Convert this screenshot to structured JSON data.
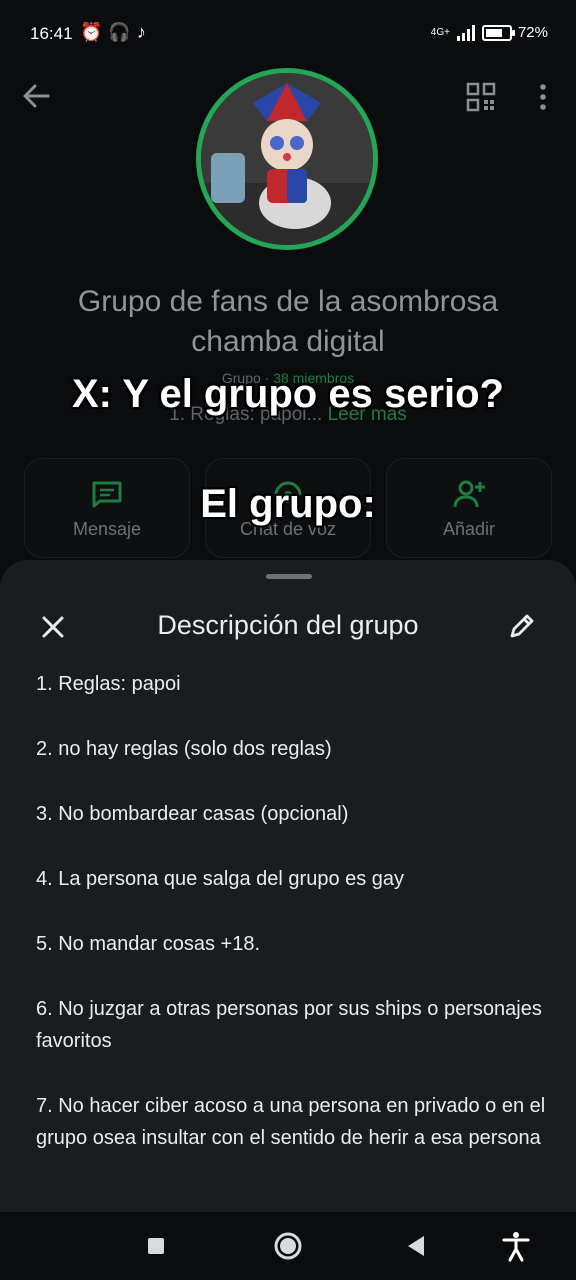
{
  "status": {
    "time": "16:41",
    "network": "4G+",
    "battery": "72%"
  },
  "group": {
    "name": "Grupo de fans de la asombrosa chamba digital",
    "type_label": "Grupo · ",
    "members": "38 miembros",
    "desc_preview": "1. Reglas: papoi... ",
    "read_more": "Leer más"
  },
  "overlay": {
    "line1": "X: Y el grupo es serio?",
    "line2": "El grupo:"
  },
  "actions": [
    {
      "label": "Mensaje"
    },
    {
      "label": "Chat de voz"
    },
    {
      "label": "Añadir"
    }
  ],
  "sheet": {
    "title": "Descripción del grupo",
    "rules": [
      "1. Reglas: papoi",
      "2. no hay reglas (solo dos reglas)",
      "3. No bombardear casas (opcional)",
      "4. La persona que salga del grupo es gay",
      "5. No mandar cosas +18.",
      "6. No juzgar a otras personas por sus ships o personajes favoritos",
      "7. No hacer ciber acoso a una persona en privado o en el grupo osea insultar con el sentido de herir a esa persona"
    ]
  },
  "colors": {
    "accent": "#23a655",
    "sheet_bg": "#1a1c1f",
    "background": "#0b0c0e"
  }
}
